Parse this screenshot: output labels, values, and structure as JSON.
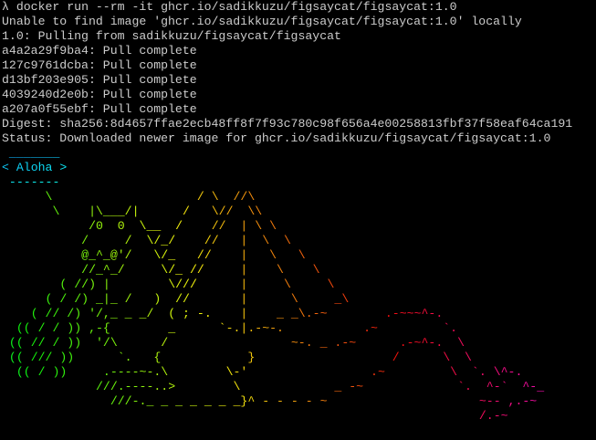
{
  "colors": {
    "background": "#000000",
    "foreground": "#cccccc"
  },
  "terminal": {
    "prompt_symbol": "λ",
    "command": "docker run --rm -it ghcr.io/sadikkuzu/figsaycat/figsaycat:1.0",
    "pull_output": {
      "unable_to_find": "Unable to find image 'ghcr.io/sadikkuzu/figsaycat/figsaycat:1.0' locally",
      "pulling_from": "1.0: Pulling from sadikkuzu/figsaycat/figsaycat",
      "layers": [
        "a4a2a29f9ba4: Pull complete",
        "127c9761dcba: Pull complete",
        "d13bf203e905: Pull complete",
        "4039240d2e0b: Pull complete",
        "a207a0f55ebf: Pull complete"
      ],
      "digest": "Digest: sha256:8d4657ffae2ecb48ff8f7f93c780c98f656a4e00258813fbf37f58eaf64ca191",
      "status": "Status: Downloaded newer image for ghcr.io/sadikkuzu/figsaycat/figsaycat:1.0"
    },
    "speech_bubble": {
      "top_border": " _______",
      "message_line": "< Aloha >",
      "bottom_border": " -------"
    },
    "dragon_art": [
      "      \\                    / \\  //\\",
      "       \\    |\\___/|      /   \\//  \\\\",
      "            /0  0  \\__  /    //  | \\ \\",
      "           /     /  \\/_/    //   |  \\  \\",
      "           @_^_@'/   \\/_   //    |   \\   \\",
      "           //_^_/     \\/_ //     |    \\    \\",
      "        ( //) |        \\///      |     \\     \\",
      "      ( / /) _|_ /   )  //       |      \\     _\\",
      "    ( // /) '/,_ _ _/  ( ; -.    |    _ _\\.-~        .-~~~^-.",
      "  (( / / )) ,-{        _      `-.|.-~-.           .~         `.",
      " (( // / ))  '/\\      /                 ~-. _ .-~      .-~^-.  \\",
      " (( /// ))      `.   {            }                   /      \\  \\",
      "  (( / ))     .----~-.\\        \\-'                 .~         \\  `. \\^-.",
      "             ///.----..>        \\             _ -~             `.  ^-`  ^-_",
      "               ///-._ _ _ _ _ _ _}^ - - - - ~                     ~-- ,.-~",
      "                                                                  /.-~"
    ]
  }
}
